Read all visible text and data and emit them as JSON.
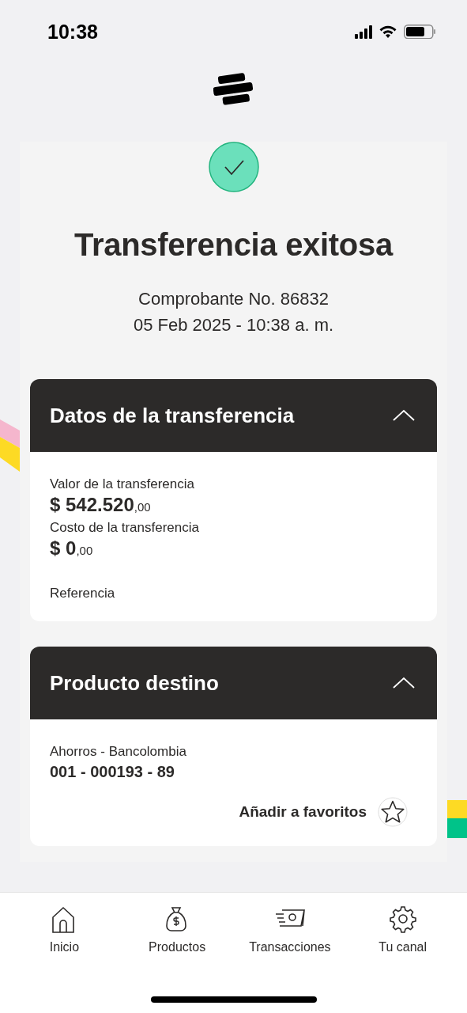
{
  "status_bar": {
    "time": "10:38"
  },
  "result": {
    "title": "Transferencia exitosa",
    "receipt": "Comprobante No. 86832",
    "datetime": "05 Feb 2025 - 10:38 a. m."
  },
  "cards": [
    {
      "title": "Datos de la transferencia",
      "expanded": true,
      "fields": [
        {
          "kind": "amount",
          "label": "Valor de la transferencia",
          "value": "$ 542.520",
          "cents": ",00"
        },
        {
          "kind": "amount",
          "label": "Costo de la transferencia",
          "value": "$ 0",
          "cents": ",00"
        },
        {
          "kind": "text",
          "label": "Referencia"
        }
      ]
    },
    {
      "title": "Producto destino",
      "expanded": true,
      "fields": [
        {
          "kind": "account",
          "label": "Ahorros - Bancolombia",
          "value": "001 - 000193 - 89"
        }
      ],
      "favorite": {
        "label": "Añadir a favoritos",
        "on": false
      }
    }
  ],
  "nav": [
    {
      "label": "Inicio",
      "kind": "home",
      "selected": false
    },
    {
      "label": "Productos",
      "kind": "bag",
      "selected": false
    },
    {
      "label": "Transacciones",
      "kind": "money",
      "selected": false
    },
    {
      "label": "Tu canal",
      "kind": "gear",
      "selected": false
    }
  ]
}
